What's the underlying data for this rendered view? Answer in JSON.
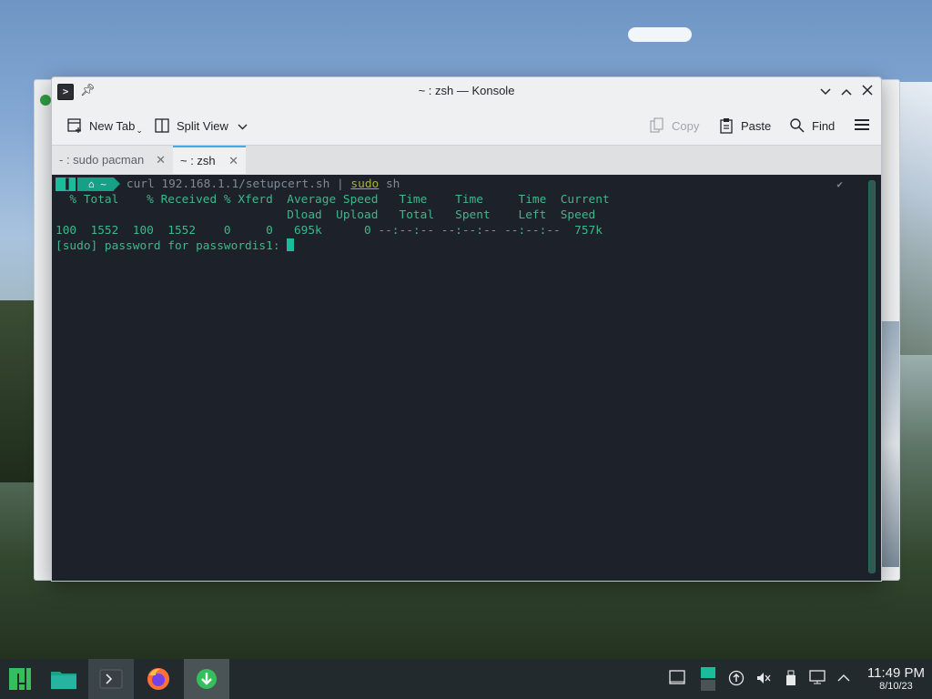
{
  "window": {
    "title": "~ : zsh — Konsole",
    "controls": [
      "minimize",
      "maximize",
      "close"
    ]
  },
  "toolbar": {
    "new_tab": "New Tab",
    "split_view": "Split View",
    "copy": "Copy",
    "paste": "Paste",
    "find": "Find"
  },
  "tabs": [
    {
      "label": "- : sudo pacman",
      "active": false
    },
    {
      "label": "~ : zsh",
      "active": true
    }
  ],
  "terminal": {
    "prompt_path": "~",
    "command_prefix": "curl 192.168.1.1/setupcert.sh | ",
    "command_sudo": "sudo",
    "command_suffix": " sh",
    "lines": [
      "  % Total    % Received % Xferd  Average Speed   Time    Time     Time  Current",
      "                                 Dload  Upload   Total   Spent    Left  Speed",
      "100  1552  100  1552    0     0   695k      0 --:--:-- --:--:-- --:--:--  757k",
      "[sudo] password for passwordis1: "
    ]
  },
  "taskbar": {
    "time": "11:49 PM",
    "date": "8/10/23"
  },
  "colors": {
    "terminal_bg": "#1d2129",
    "terminal_fg": "#3fb68b",
    "accent": "#3daee9",
    "taskbar_bg": "#232a2e"
  }
}
